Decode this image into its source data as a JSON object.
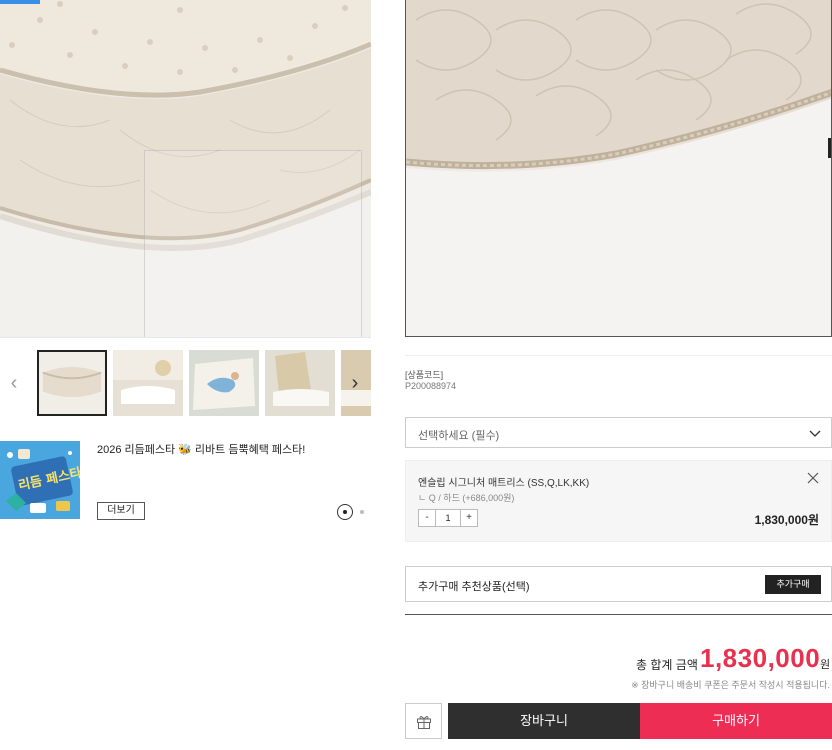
{
  "gallery": {
    "main_image_icon": "mattress-photo",
    "prev_icon": "chevron-left-icon",
    "next_icon": "chevron-right-icon",
    "thumbnails": [
      {
        "icon": "mattress-thumbnail",
        "selected": true
      },
      {
        "icon": "bedroom-thumbnail",
        "selected": false
      },
      {
        "icon": "person-on-mattress-thumbnail",
        "selected": false
      },
      {
        "icon": "bedroom-thumbnail",
        "selected": false
      },
      {
        "icon": "bedroom-thumbnail",
        "selected": false
      }
    ]
  },
  "banner": {
    "title": "2026 리듬페스타 🐝 리바트 듬뿍혜택 페스타!",
    "more_label": "더보기",
    "image_icon": "festa-banner-image",
    "image_text": "리듬 페스타",
    "bg_color": "#4aa6de",
    "active_dot": 1,
    "dot_count": 2
  },
  "product": {
    "code_label": "[상품코드]",
    "code_value": "P200088974"
  },
  "option_select": {
    "placeholder": "선택하세요 (필수)"
  },
  "selected_item": {
    "name": "엔슬립 시그니처 매트리스 (SS,Q,LK,KK)",
    "option": "ㄴ Q / 하드 (+686,000원)",
    "quantity": "1",
    "minus_label": "-",
    "plus_label": "+",
    "price": "1,830,000원"
  },
  "addon": {
    "label": "추가구매 추천상품(선택)",
    "button_label": "추가구매"
  },
  "total": {
    "label": "총 합계 금액",
    "value": "1,830,000",
    "unit": "원",
    "notice": "※ 장바구니 배송비 쿠폰은 주문서 작성시 적용됩니다."
  },
  "actions": {
    "cart_label": "장바구니",
    "buy_label": "구매하기",
    "gift_icon": "gift-icon"
  },
  "colors": {
    "accent": "#ee2d54",
    "price_red": "#e8314f",
    "dark_button": "#2f2f2f"
  }
}
